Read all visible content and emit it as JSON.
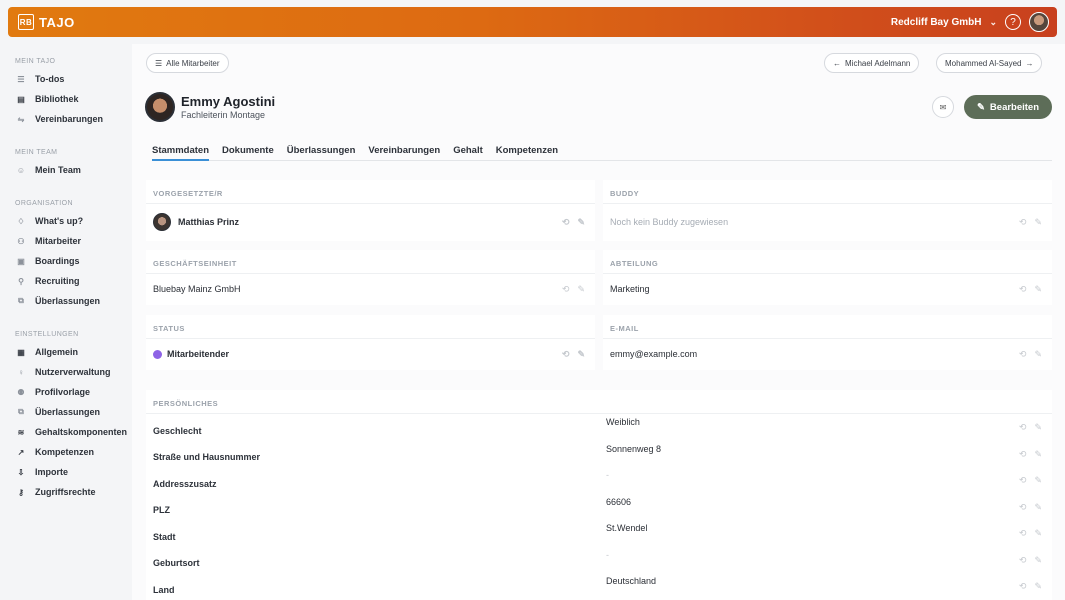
{
  "topbar": {
    "brand_mark": "RB",
    "brand": "TAJO",
    "company": "Redcliff Bay GmbH",
    "chevron": "⌄",
    "help": "?"
  },
  "sidebar": {
    "sections": [
      {
        "title": "MEIN TAJO",
        "items": [
          {
            "label": "To-dos",
            "icon": "list-icon"
          },
          {
            "label": "Bibliothek",
            "icon": "book-icon"
          },
          {
            "label": "Vereinbarungen",
            "icon": "handshake-icon"
          }
        ]
      },
      {
        "title": "MEIN TEAM",
        "items": [
          {
            "label": "Mein Team",
            "icon": "smile-icon"
          }
        ]
      },
      {
        "title": "ORGANISATION",
        "items": [
          {
            "label": "What's up?",
            "icon": "bell-icon"
          },
          {
            "label": "Mitarbeiter",
            "icon": "people-icon"
          },
          {
            "label": "Boardings",
            "icon": "clipboard-icon"
          },
          {
            "label": "Recruiting",
            "icon": "user-plus-icon"
          },
          {
            "label": "Überlassungen",
            "icon": "transfer-icon"
          }
        ]
      },
      {
        "title": "EINSTELLUNGEN",
        "items": [
          {
            "label": "Allgemein",
            "icon": "building-icon"
          },
          {
            "label": "Nutzerverwaltung",
            "icon": "user-icon"
          },
          {
            "label": "Profilvorlage",
            "icon": "profile-template-icon"
          },
          {
            "label": "Überlassungen",
            "icon": "transfer-icon"
          },
          {
            "label": "Gehaltskomponenten",
            "icon": "coins-icon"
          },
          {
            "label": "Kompetenzen",
            "icon": "chart-icon"
          },
          {
            "label": "Importe",
            "icon": "import-icon"
          },
          {
            "label": "Zugriffsrechte",
            "icon": "key-icon"
          }
        ]
      }
    ]
  },
  "nav": {
    "all_employees": "Alle Mitarbeiter",
    "prev": "Michael Adelmann",
    "next": "Mohammed Al-Sayed"
  },
  "employee": {
    "name": "Emmy Agostini",
    "role": "Fachleiterin Montage"
  },
  "buttons": {
    "edit": "Bearbeiten"
  },
  "tabs": [
    "Stammdaten",
    "Dokumente",
    "Überlassungen",
    "Vereinbarungen",
    "Gehalt",
    "Kompetenzen"
  ],
  "cards": {
    "supervisor": {
      "title": "VORGESETZTE/R",
      "value": "Matthias Prinz"
    },
    "buddy": {
      "title": "BUDDY",
      "value": "Noch kein Buddy zugewiesen"
    },
    "business_unit": {
      "title": "GESCHÄFTSEINHEIT",
      "value": "Bluebay Mainz GmbH"
    },
    "department": {
      "title": "ABTEILUNG",
      "value": "Marketing"
    },
    "status": {
      "title": "STATUS",
      "value": "Mitarbeitender",
      "color": "#8e63e6"
    },
    "email": {
      "title": "E-MAIL",
      "value": "emmy@example.com"
    }
  },
  "personal": {
    "title": "PERSÖNLICHES",
    "rows": [
      {
        "label": "Geschlecht",
        "value": "Weiblich"
      },
      {
        "label": "Straße und Hausnummer",
        "value": "Sonnenweg 8"
      },
      {
        "label": "Addresszusatz",
        "value": "-"
      },
      {
        "label": "PLZ",
        "value": "66606"
      },
      {
        "label": "Stadt",
        "value": "St.Wendel"
      },
      {
        "label": "Geburtsort",
        "value": "-"
      },
      {
        "label": "Land",
        "value": "Deutschland"
      }
    ]
  },
  "icons": {
    "history": "⟲",
    "edit": "✎",
    "list": "☰",
    "arrow_left": "←",
    "arrow_right": "→",
    "mail": "✉"
  },
  "colors": {
    "accent": "#3a8fd6",
    "edit_button": "#5d6d58",
    "topbar_start": "#e17a10",
    "topbar_end": "#c8401e"
  }
}
